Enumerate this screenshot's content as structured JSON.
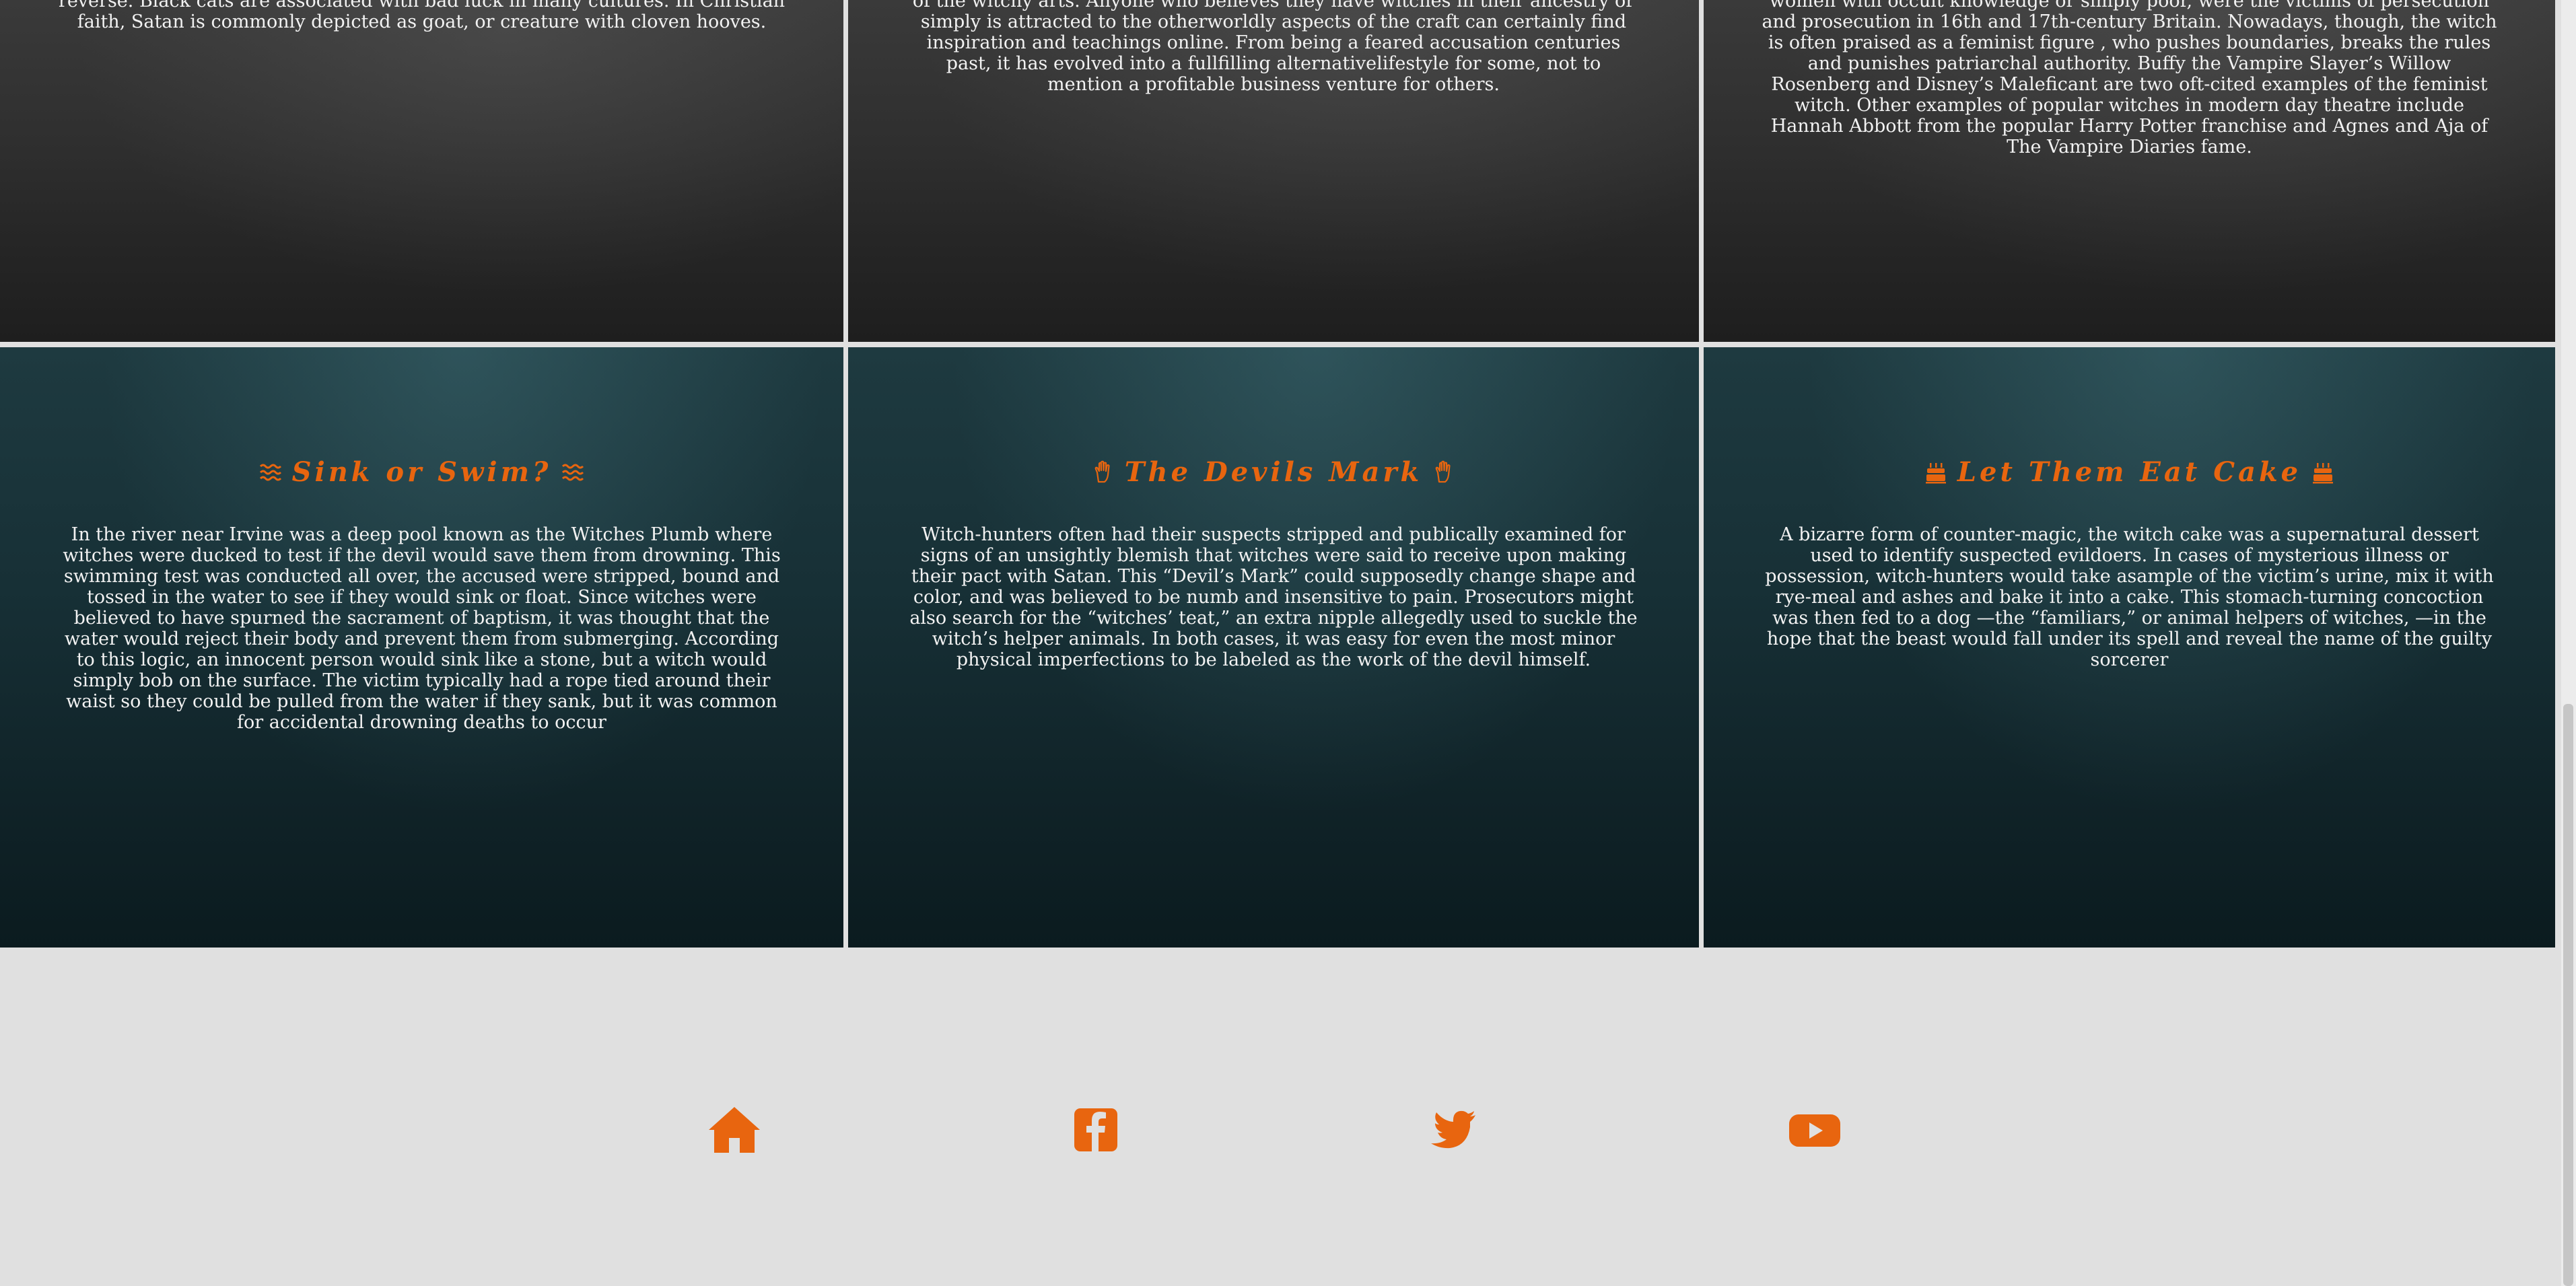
{
  "top_panels": [
    {
      "text": "reverse. Black cats are associated with bad luck in many cultures. In Christian faith, Satan is commonly depicted as goat, or creature with cloven hooves."
    },
    {
      "text": "of the witchy arts. Anyone who believes they have witches in their ancestry or simply is attracted to the otherworldly aspects of the craft can certainly find inspiration and teachings online. From being a feared accusation centuries past, it has evolved into a fullfilling alternativelifestyle for some, not to mention a profitable business venture for others."
    },
    {
      "text": "women with occult knowledge or simply poor, were the victims of persecution and prosecution in 16th and 17th-century Britain. Nowadays, though, the witch is often praised as a feminist figure , who pushes boundaries, breaks the rules and punishes patriarchal authority. Buffy the Vampire Slayer’s Willow Rosenberg and Disney’s Maleficant are two oft-cited examples of the feminist witch. Other examples of popular witches in modern day theatre include Hannah Abbott from the popular Harry Potter franchise and Agnes and Aja of The Vampire Diaries fame."
    }
  ],
  "bottom_panels": [
    {
      "title": "Sink or Swim?",
      "icon": "water-waves-icon",
      "text": "In the river near Irvine was a deep pool known as the Witches Plumb where witches were ducked to test if the devil would save them from drowning. This swimming test was conducted all over, the accused were stripped, bound and tossed in the water to see if they would sink or float. Since witches were believed to have spurned the sacrament of baptism, it was thought that the water would reject their body and prevent them from submerging. According to this logic, an innocent person would sink like a stone, but a witch would simply bob on the surface. The victim typically had a rope tied around their waist so they could be pulled from the water if they sank, but it was common for accidental drowning deaths to occur"
    },
    {
      "title": "The Devils Mark",
      "icon": "hand-icon",
      "text": "Witch-hunters often had their suspects stripped and publically examined for signs of an unsightly blemish that witches were said to receive upon making their pact with Satan. This “Devil’s Mark” could supposedly change shape and color, and was believed to be numb and insensitive to pain. Prosecutors might also search for the “witches’ teat,” an extra nipple allegedly used to suckle the witch’s helper animals. In both cases, it was easy for even the most minor physical imperfections to be labeled as the work of the devil himself."
    },
    {
      "title": "Let Them Eat Cake",
      "icon": "cake-icon",
      "text": "A bizarre form of counter-magic, the witch cake was a supernatural dessert used to identify suspected evildoers. In cases of mysterious illness or possession, witch-hunters would take asample of the victim’s urine, mix it with rye-meal and ashes and bake it into a cake. This stomach-turning concoction was then fed to a dog —the “familiars,” or animal helpers of witches, —in the hope that the beast would fall under its spell and reveal the name of the guilty sorcerer"
    }
  ],
  "footer": {
    "links": [
      {
        "icon": "home-icon"
      },
      {
        "icon": "facebook-icon"
      },
      {
        "icon": "twitter-icon"
      },
      {
        "icon": "youtube-icon"
      }
    ]
  },
  "colors": {
    "accent": "#e8650f",
    "footer_bg": "#e0e0e0"
  }
}
